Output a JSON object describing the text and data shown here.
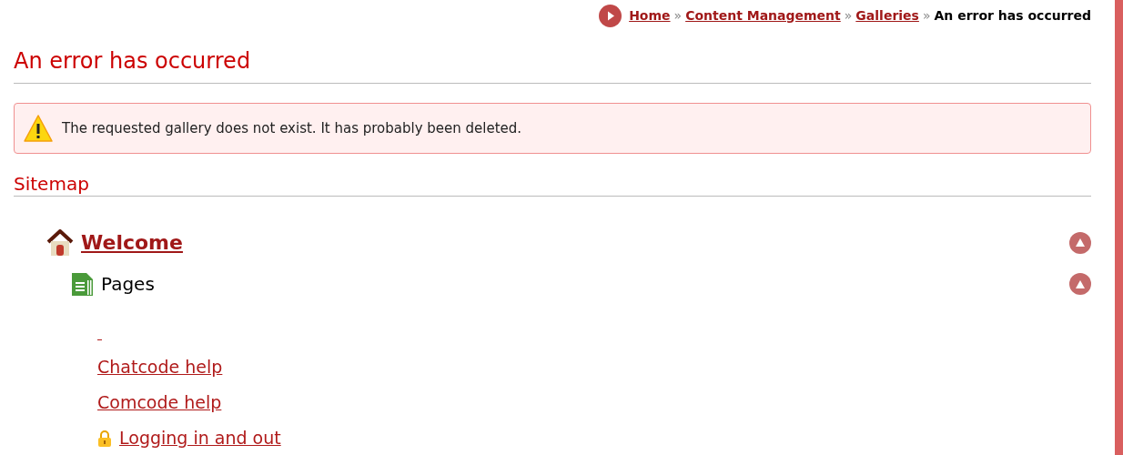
{
  "breadcrumb": [
    {
      "label": "Home",
      "kind": "link"
    },
    {
      "label": "Content Management",
      "kind": "link"
    },
    {
      "label": "Galleries",
      "kind": "link"
    },
    {
      "label": "An error has occurred",
      "kind": "current"
    }
  ],
  "breadcrumb_separator": "»",
  "title": "An error has occurred",
  "message": "The requested gallery does not exist. It has probably been deleted.",
  "sitemap": {
    "heading": "Sitemap",
    "root": {
      "label": "Welcome",
      "expanded": true,
      "children": [
        {
          "label": "Pages",
          "expanded": true,
          "children": [
            {
              "kind": "empty-link"
            },
            {
              "label": "Chatcode help",
              "kind": "link"
            },
            {
              "label": "Comcode help",
              "kind": "link"
            },
            {
              "label": "Logging in and out",
              "kind": "locked-link"
            }
          ]
        }
      ]
    }
  }
}
